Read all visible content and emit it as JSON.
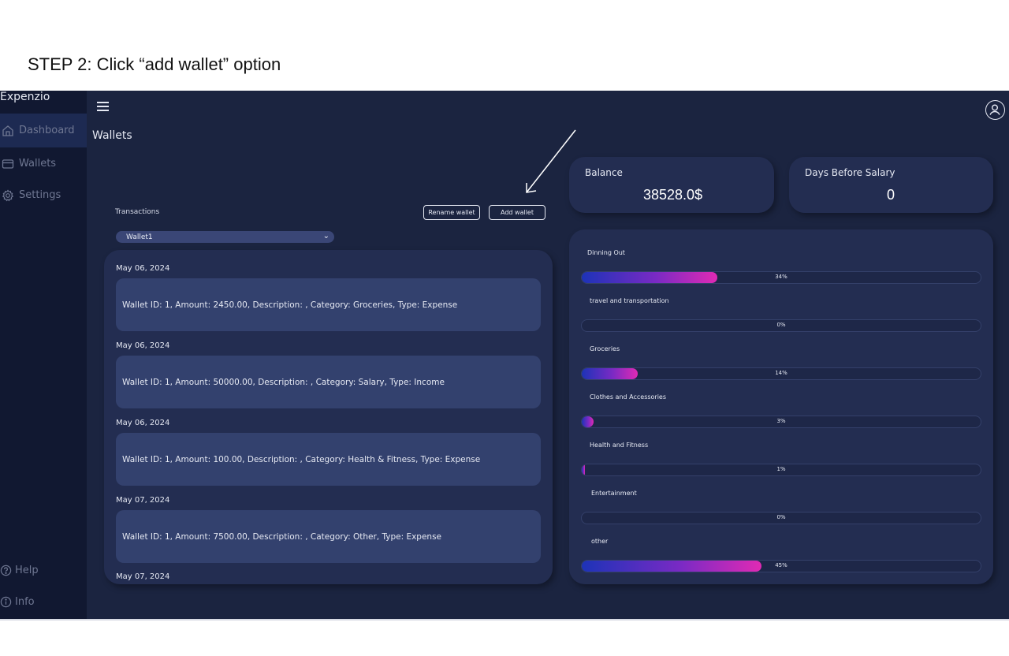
{
  "caption": "STEP 2: Click “add wallet” option",
  "app": {
    "brand": "Expenzio",
    "page_title": "Wallets"
  },
  "sidebar": {
    "items": [
      {
        "label": "Dashboard",
        "icon": "home-icon",
        "active": true
      },
      {
        "label": "Wallets",
        "icon": "wallet-icon",
        "active": false
      },
      {
        "label": "Settings",
        "icon": "gear-icon",
        "active": false
      }
    ],
    "footer": [
      {
        "label": "Help",
        "icon": "help-icon"
      },
      {
        "label": "Info",
        "icon": "info-icon"
      }
    ]
  },
  "transactions": {
    "label": "Transactions",
    "rename_label": "Rename wallet",
    "add_label": "Add wallet",
    "selected_wallet": "Wallet1",
    "items": [
      {
        "date": "May 06, 2024",
        "text": "Wallet ID: 1, Amount: 2450.00, Description: , Category: Groceries, Type: Expense"
      },
      {
        "date": "May 06, 2024",
        "text": "Wallet ID: 1, Amount: 50000.00, Description: , Category: Salary, Type: Income"
      },
      {
        "date": "May 06, 2024",
        "text": "Wallet ID: 1, Amount: 100.00, Description: , Category: Health & Fitness, Type: Expense"
      },
      {
        "date": "May 07, 2024",
        "text": "Wallet ID: 1, Amount: 7500.00, Description: , Category: Other, Type: Expense"
      },
      {
        "date": "May 07, 2024",
        "text": ""
      }
    ]
  },
  "balance": {
    "label": "Balance",
    "value": "38528.0$"
  },
  "salary": {
    "label": "Days Before Salary",
    "value": "0"
  },
  "categories": [
    {
      "name": "Dinning Out",
      "pct_label": "34%",
      "pct": 34
    },
    {
      "name": "travel and transportation",
      "pct_label": "0%",
      "pct": 0
    },
    {
      "name": "Groceries",
      "pct_label": "14%",
      "pct": 14
    },
    {
      "name": "Clothes and Accessories",
      "pct_label": "3%",
      "pct": 3
    },
    {
      "name": "Health  and Fitness",
      "pct_label": "1%",
      "pct": 1
    },
    {
      "name": "Entertainment",
      "pct_label": "0%",
      "pct": 0
    },
    {
      "name": "other",
      "pct_label": "45%",
      "pct": 45
    }
  ],
  "colors": {
    "sidebar_bg": "#111831",
    "app_bg": "#1b2440",
    "panel_bg": "#232d51",
    "card_bg": "#33416e",
    "bar_gradient_start": "#1d33b8",
    "bar_gradient_end": "#e02ab4"
  }
}
